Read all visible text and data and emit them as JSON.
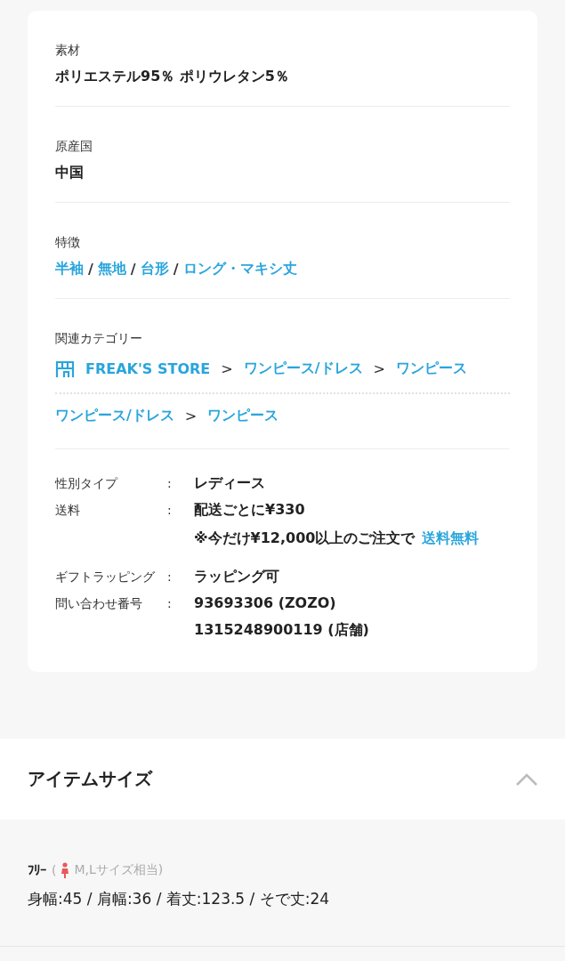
{
  "sections": [
    {
      "label": "素材",
      "value": "ポリエステル95％ ポリウレタン5％"
    },
    {
      "label": "原産国",
      "value": "中国"
    }
  ],
  "features": {
    "label": "特徴",
    "separator": "/",
    "tags": [
      "半袖",
      "無地",
      "台形",
      "ロング・マキシ丈"
    ]
  },
  "categories": {
    "label": "関連カテゴリー",
    "separator": ">",
    "paths": [
      {
        "kind": "store",
        "items": [
          "FREAK'S STORE",
          "ワンピース/ドレス",
          "ワンピース"
        ]
      },
      {
        "kind": "plain",
        "items": [
          "ワンピース/ドレス",
          "ワンピース"
        ]
      }
    ]
  },
  "details": [
    [
      {
        "label": "性別タイプ",
        "colon": ":",
        "lines": [
          {
            "text": "レディース"
          }
        ]
      },
      {
        "label": "送料",
        "colon": ":",
        "lines": [
          {
            "text": "配送ごとに¥330"
          },
          {
            "text": "※今だけ¥12,000以上のご注文で",
            "link": "送料無料"
          }
        ]
      }
    ],
    [
      {
        "label": "ギフトラッピング",
        "colon": ":",
        "lines": [
          {
            "text": "ラッピング可"
          }
        ]
      },
      {
        "label": "問い合わせ番号",
        "colon": ":",
        "lines": [
          {
            "text": "93693306 (ZOZO)"
          },
          {
            "text": "1315248900119 (店舗)"
          }
        ]
      }
    ]
  ],
  "size_panel": {
    "title": "アイテムサイズ",
    "expanded": true,
    "sizes": [
      {
        "name": "ﾌﾘｰ",
        "paren_open": "(",
        "note": "M,Lサイズ相当)",
        "measurements": "身幅:45 / 肩幅:36 / 着丈:123.5 / そで丈:24"
      }
    ]
  }
}
